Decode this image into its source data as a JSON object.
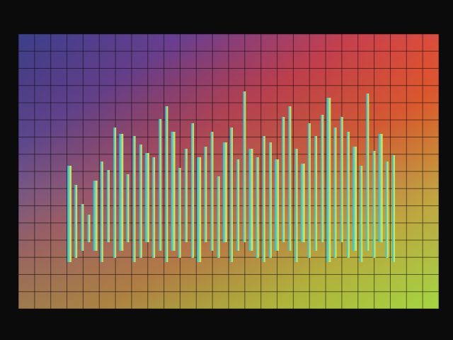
{
  "chart_data": {
    "type": "bar",
    "title": "",
    "xlabel": "",
    "ylabel": "",
    "ylim": [
      0,
      100
    ],
    "grid": true,
    "legend": "none",
    "x_ticks": [
      "",
      "",
      "",
      "",
      "",
      "",
      "",
      "",
      "",
      "",
      "",
      "",
      "",
      ""
    ],
    "y_ticks": [
      "",
      "",
      "",
      "",
      "",
      "",
      "",
      "",
      "",
      "",
      "",
      "",
      "",
      "",
      ""
    ],
    "colors": {
      "background": "#0b0b0c",
      "gradient": [
        "#3b3f8a",
        "#6a3f8f",
        "#c7404f",
        "#f05a2a",
        "#f3a51e",
        "#e5d82a"
      ],
      "grid": "#000000"
    },
    "series": [
      {
        "values": [
          42,
          33,
          24,
          19,
          35,
          44,
          40,
          60,
          57,
          38,
          56,
          52,
          48,
          46,
          64,
          70,
          58,
          41,
          50,
          62,
          46,
          51,
          58,
          37,
          53,
          60,
          45,
          77,
          50,
          46,
          56,
          53,
          45,
          65,
          70,
          50,
          43,
          62,
          56,
          66,
          74,
          60,
          65,
          58,
          51,
          42,
          76,
          49,
          57,
          44,
          47
        ]
      }
    ]
  }
}
